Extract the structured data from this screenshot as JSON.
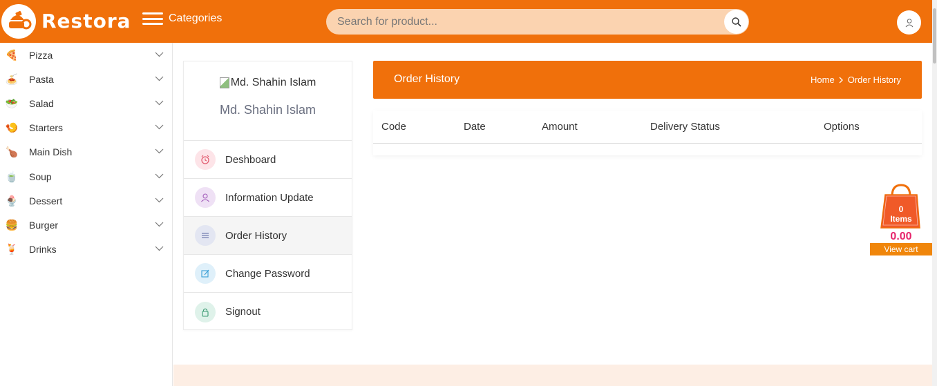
{
  "brand": {
    "name": "Restora",
    "accent": "#f0700b"
  },
  "header": {
    "categories_label": "Categories",
    "search_placeholder": "Search for product..."
  },
  "sidebar": {
    "items": [
      {
        "label": "Pizza",
        "icon": "pizza-icon"
      },
      {
        "label": "Pasta",
        "icon": "pasta-icon"
      },
      {
        "label": "Salad",
        "icon": "salad-icon"
      },
      {
        "label": "Starters",
        "icon": "starters-icon"
      },
      {
        "label": "Main Dish",
        "icon": "main-dish-icon"
      },
      {
        "label": "Soup",
        "icon": "soup-icon"
      },
      {
        "label": "Dessert",
        "icon": "dessert-icon"
      },
      {
        "label": "Burger",
        "icon": "burger-icon"
      },
      {
        "label": "Drinks",
        "icon": "drinks-icon"
      }
    ]
  },
  "profile": {
    "avatar_alt": "Md. Shahin Islam",
    "name": "Md. Shahin Islam",
    "menu": [
      {
        "label": "Deshboard",
        "icon": "alarm-clock-icon",
        "active": false
      },
      {
        "label": "Information Update",
        "icon": "user-icon",
        "active": false
      },
      {
        "label": "Order History",
        "icon": "list-icon",
        "active": true
      },
      {
        "label": "Change Password",
        "icon": "edit-icon",
        "active": false
      },
      {
        "label": "Signout",
        "icon": "lock-icon",
        "active": false
      }
    ]
  },
  "order_history": {
    "title": "Order History",
    "breadcrumb": {
      "home": "Home",
      "current": "Order History"
    },
    "columns": [
      "Code",
      "Date",
      "Amount",
      "Delivery Status",
      "Options"
    ]
  },
  "cart": {
    "count": "0",
    "items_label": "Items",
    "amount": "0.00",
    "view_cart": "View cart"
  }
}
